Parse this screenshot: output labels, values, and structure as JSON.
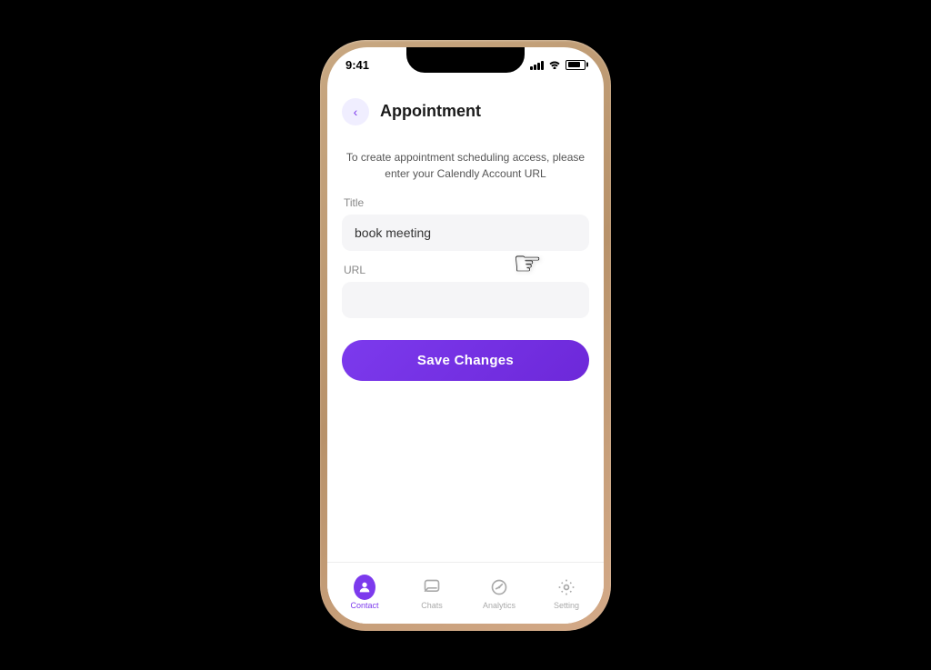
{
  "status_bar": {
    "time": "9:41"
  },
  "header": {
    "back_label": "‹",
    "title": "Appointment"
  },
  "description": {
    "text": "To create appointment scheduling access, please enter your Calendly Account URL"
  },
  "form": {
    "title_label": "Title",
    "title_placeholder": "book meeting",
    "title_value": "book meeting",
    "url_label": "URL",
    "url_placeholder": "",
    "url_value": ""
  },
  "save_button": {
    "label": "Save Changes"
  },
  "bottom_nav": {
    "items": [
      {
        "label": "Contact",
        "active": true
      },
      {
        "label": "Chats",
        "active": false
      },
      {
        "label": "Analytics",
        "active": false
      },
      {
        "label": "Setting",
        "active": false
      }
    ]
  }
}
